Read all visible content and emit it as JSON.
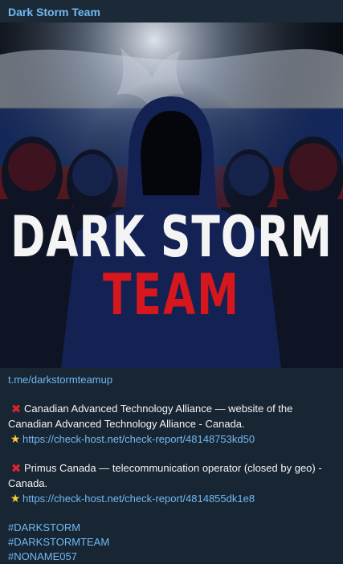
{
  "channel": {
    "title": "Dark Storm Team"
  },
  "media": {
    "title_line1": "DARK STORM",
    "title_line2": "TEAM",
    "colors": {
      "accent_red": "#d6171d",
      "title_white": "#f4f4f4"
    }
  },
  "message": {
    "top_link": "t.me/darkstormteamup",
    "items": [
      {
        "icon": "cross-mark-icon",
        "text": "Canadian Advanced Technology Alliance — website of the Canadian Advanced Technology Alliance - Canada.",
        "link_icon": "glowing-star-icon",
        "link": "https://check-host.net/check-report/48148753kd50"
      },
      {
        "icon": "cross-mark-icon",
        "text": "Primus Canada — telecommunication operator (closed by geo) - Canada.",
        "link_icon": "glowing-star-icon",
        "link": "https://check-host.net/check-report/4814855dk1e8"
      }
    ],
    "hashtags": [
      "#DARKSTORM",
      "#DARKSTORMTEAM",
      "#NONAME057"
    ]
  },
  "theme": {
    "link_color": "#71b9f2",
    "background": "#182533"
  }
}
